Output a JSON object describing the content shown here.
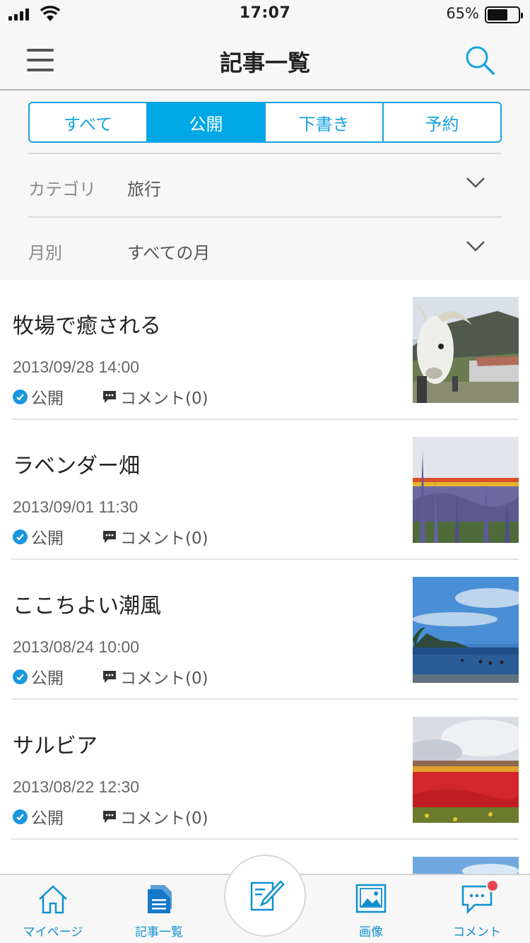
{
  "status_bar": {
    "time": "17:07",
    "battery": "65%"
  },
  "navbar": {
    "title": "記事一覧",
    "menu_icon": "hamburger-menu-icon",
    "search_icon": "search-icon"
  },
  "segments": [
    {
      "label": "すべて",
      "active": false
    },
    {
      "label": "公開",
      "active": true
    },
    {
      "label": "下書き",
      "active": false
    },
    {
      "label": "予約",
      "active": false
    }
  ],
  "filters": {
    "category": {
      "label": "カテゴリ",
      "value": "旅行"
    },
    "month": {
      "label": "月別",
      "value": "すべての月"
    }
  },
  "articles": [
    {
      "title": "牧場で癒される",
      "date": "2013/09/28 14:00",
      "status": "公開",
      "comments": "コメント(0)",
      "thumb": "goat-photo"
    },
    {
      "title": "ラベンダー畑",
      "date": "2013/09/01 11:30",
      "status": "公開",
      "comments": "コメント(0)",
      "thumb": "lavender-photo"
    },
    {
      "title": "ここちよい潮風",
      "date": "2013/08/24 10:00",
      "status": "公開",
      "comments": "コメント(0)",
      "thumb": "ocean-photo"
    },
    {
      "title": "サルビア",
      "date": "2013/08/22 12:30",
      "status": "公開",
      "comments": "コメント(0)",
      "thumb": "salvia-photo"
    }
  ],
  "tabbar": {
    "my_page": "マイページ",
    "articles": "記事一覧",
    "images": "画像",
    "comments": "コメント"
  },
  "colors": {
    "accent": "#00a7e6",
    "tab_text": "#0f8fd0",
    "badge": "#e8474f"
  }
}
